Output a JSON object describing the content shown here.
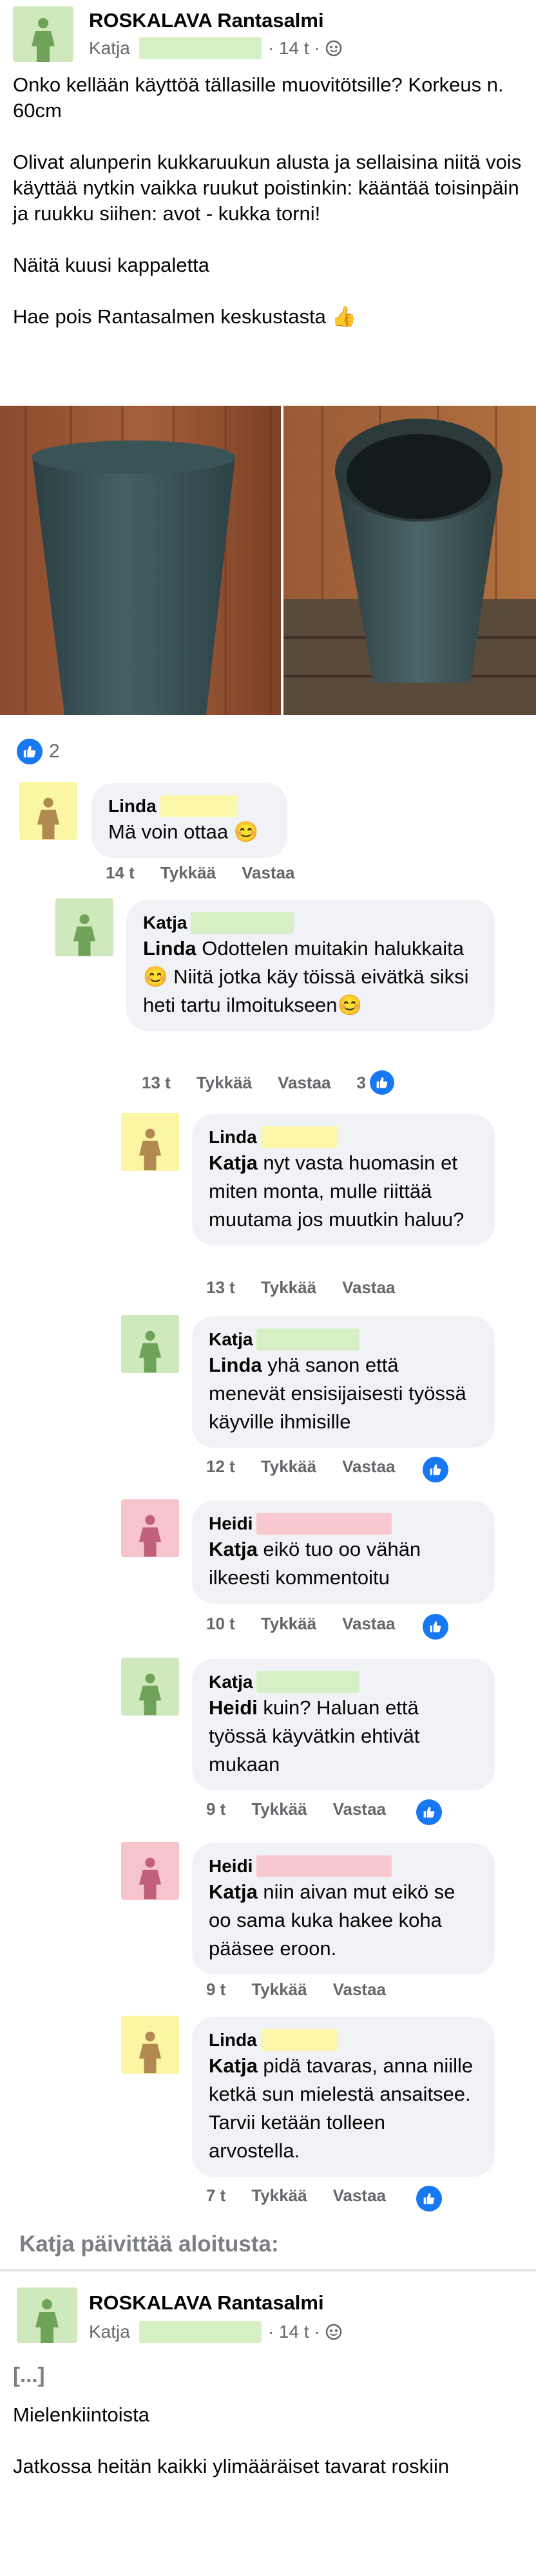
{
  "post": {
    "page_name": "ROSKALAVA Rantasalmi",
    "author": "Katja",
    "time": "· 14 t ·",
    "text": "Onko kellään käyttöä tällasille muovitötsille? Korkeus n. 60cm\n\nOlivat alunperin kukkaruukun alusta ja sellaisina niitä vois käyttää nytkin vaikka ruukut poistinkin: kääntää toisinpäin ja ruukku siihen: avot - kukka torni!\n\nNäitä kuusi kappaletta\n\nHae pois Rantasalmen keskustasta 👍",
    "reaction_count": "2",
    "reaction_icon": "like-icon"
  },
  "colors": {
    "accent": "#1877f2",
    "highlight_green": "#d6efc4",
    "highlight_yellow": "#fbf9a9",
    "highlight_pink": "#f9c9d0"
  },
  "comments": [
    {
      "author": "Linda",
      "text_bold": "",
      "text": "Mä voin ottaa 😊",
      "time": "14 t",
      "like": "Tykkää",
      "reply": "Vastaa",
      "reactions": ""
    },
    {
      "author": "Katja",
      "text_bold": "Linda",
      "text": " Odottelen muitakin halukkaita😊 Niitä jotka käy töissä eivätkä siksi heti tartu ilmoitukseen😊",
      "time": "13 t",
      "like": "Tykkää",
      "reply": "Vastaa",
      "reactions": "3"
    },
    {
      "author": "Linda",
      "text_bold": "Katja",
      "text": " nyt vasta huomasin et miten monta, mulle riittää muutama jos muutkin haluu?",
      "time": "13 t",
      "like": "Tykkää",
      "reply": "Vastaa",
      "reactions": ""
    },
    {
      "author": "Katja",
      "text_bold": "Linda",
      "text": " yhä sanon että menevät ensisijaisesti työssä käyville ihmisille",
      "time": "12 t",
      "like": "Tykkää",
      "reply": "Vastaa",
      "reactions": ""
    },
    {
      "author": "Heidi",
      "text_bold": "Katja",
      "text": " eikö tuo oo vähän ilkeesti kommentoitu",
      "time": "10 t",
      "like": "Tykkää",
      "reply": "Vastaa",
      "reactions": ""
    },
    {
      "author": "Katja",
      "text_bold": "Heidi",
      "text": " kuin? Haluan että työssä käyvätkin ehtivät mukaan",
      "time": "9 t",
      "like": "Tykkää",
      "reply": "Vastaa",
      "reactions": ""
    },
    {
      "author": "Heidi",
      "text_bold": "Katja",
      "text": " niin aivan mut eikö se oo sama kuka hakee koha pääsee eroon.",
      "time": "9 t",
      "like": "Tykkää",
      "reply": "Vastaa",
      "reactions": ""
    },
    {
      "author": "Linda",
      "text_bold": "Katja",
      "text": " pidä tavaras, anna niille ketkä sun mielestä ansaitsee. Tarvii ketään tolleen arvostella.",
      "time": "7 t",
      "like": "Tykkää",
      "reply": "Vastaa",
      "reactions": ""
    }
  ],
  "update": {
    "title": "Katja päivittää aloitusta:",
    "page_name": "ROSKALAVA Rantasalmi",
    "author": "Katja",
    "time": "· 14 t ·",
    "ellipsis": "[...]",
    "text": "Mielenkiintoista\n\nJatkossa heitän kaikki ylimääräiset tavarat roskiin"
  }
}
